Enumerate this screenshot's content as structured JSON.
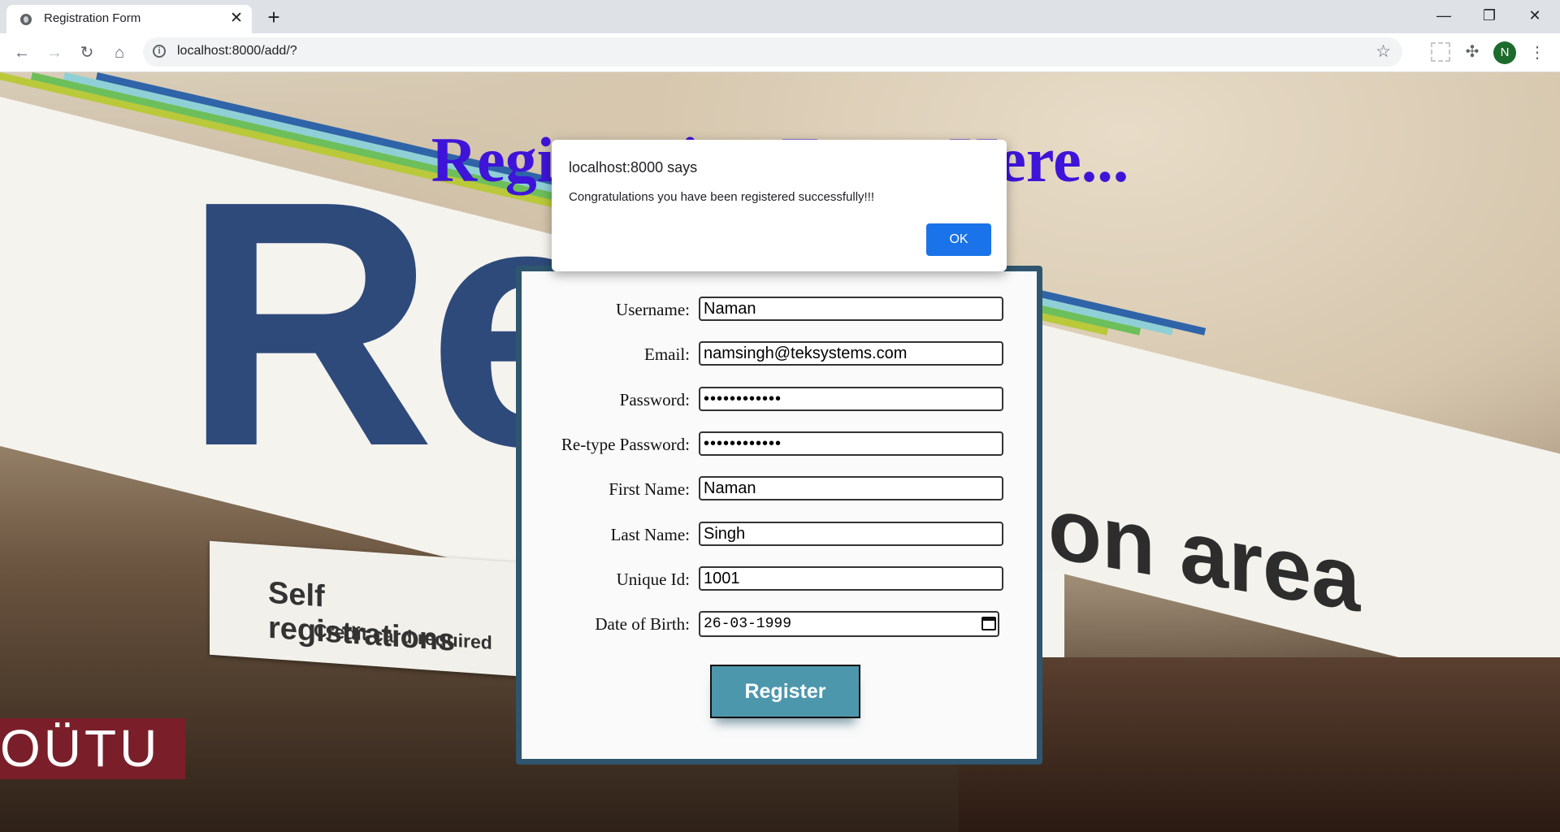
{
  "browser": {
    "tab_title": "Registration Form",
    "tab_close": "✕",
    "new_tab": "+",
    "url": "localhost:8000/add/?",
    "profile_initial": "N",
    "window": {
      "minimize": "—",
      "restore": "❐",
      "close": "✕"
    }
  },
  "page": {
    "heading": "Registration Form Here...",
    "background": {
      "big_letters": "Re",
      "right_sign": "on area",
      "self_sign_line1": "Self registrations",
      "self_sign_line2": "Credit card required",
      "store_sign": "OÜTU"
    }
  },
  "form": {
    "fields": [
      {
        "label": "Username:",
        "value": "Naman"
      },
      {
        "label": "Email:",
        "value": "namsingh@teksystems.com"
      },
      {
        "label": "Password:",
        "value": "••••••••••••"
      },
      {
        "label": "Re-type Password:",
        "value": "••••••••••••"
      },
      {
        "label": "First Name:",
        "value": "Naman"
      },
      {
        "label": "Last Name:",
        "value": "Singh"
      },
      {
        "label": "Unique Id:",
        "value": "1001"
      },
      {
        "label": "Date of Birth:",
        "value": "26-03-1999"
      }
    ],
    "submit_label": "Register"
  },
  "dialog": {
    "origin": "localhost:8000 says",
    "message": "Congratulations you have been registered successfully!!!",
    "ok_label": "OK"
  },
  "colors": {
    "heading": "#3e14d8",
    "card_border": "#2f566e",
    "register_button": "#4d97ad",
    "dialog_ok": "#1a73e8"
  }
}
